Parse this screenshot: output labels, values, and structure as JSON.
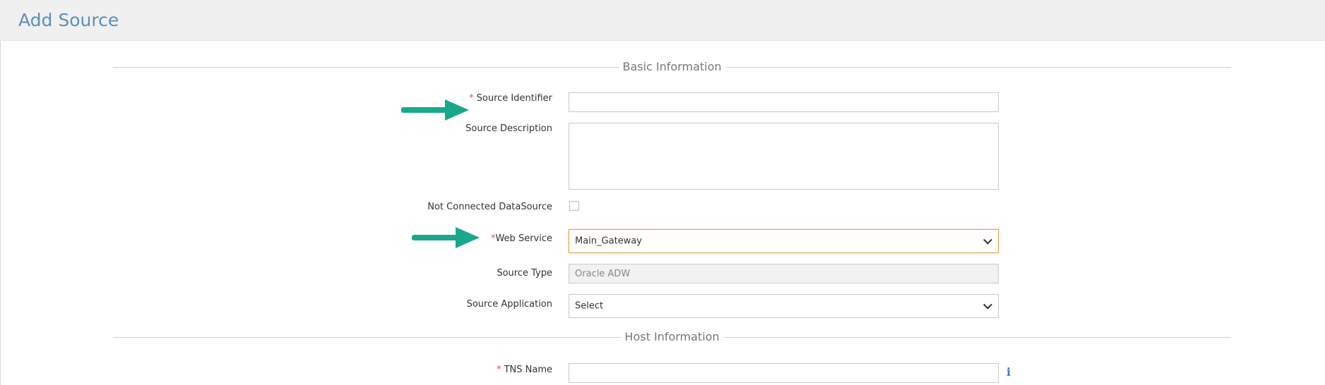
{
  "header": {
    "title": "Add Source"
  },
  "sections": {
    "basic": "Basic Information",
    "host": "Host Information"
  },
  "form": {
    "source_identifier": {
      "label": "Source Identifier",
      "required_marker": "*",
      "value": ""
    },
    "source_description": {
      "label": "Source Description",
      "value": ""
    },
    "not_connected": {
      "label": "Not Connected DataSource",
      "checked": false
    },
    "web_service": {
      "label": "Web Service",
      "required_marker": "*",
      "value": "Main_Gateway"
    },
    "source_type": {
      "label": "Source Type",
      "value": "Oracle ADW"
    },
    "source_application": {
      "label": "Source Application",
      "value": "Select"
    },
    "tns_name": {
      "label": "TNS Name",
      "required_marker": "*",
      "value": ""
    }
  },
  "icons": {
    "arrow": "arrow-right-icon",
    "info": "info-icon",
    "chevron": "chevron-down-icon"
  },
  "colors": {
    "title": "#5b8fbe",
    "required": "#d9534f",
    "arrow": "#1aa88a",
    "focus": "#e8a04a",
    "info": "#3d7fc0"
  }
}
